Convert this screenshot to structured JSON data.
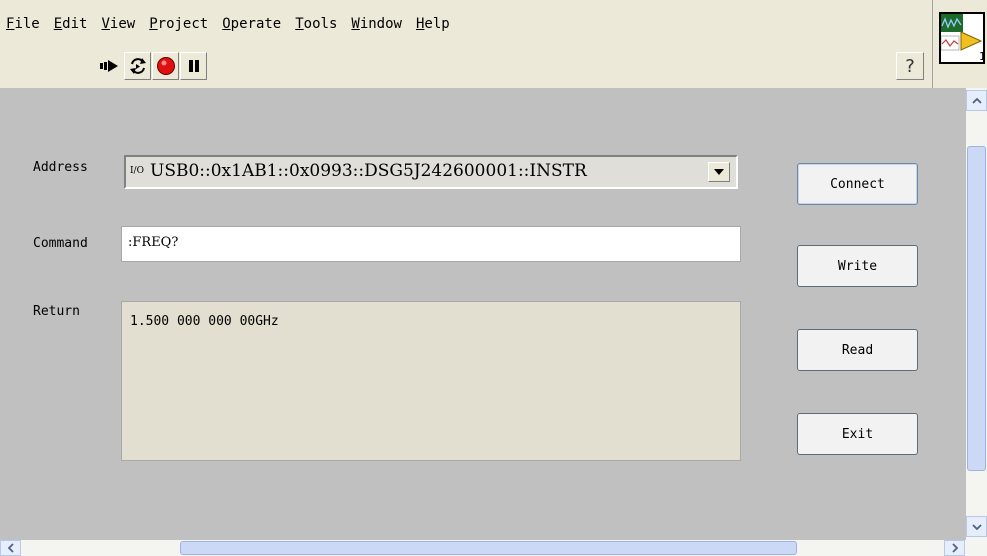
{
  "menu": {
    "items": [
      {
        "accel": "F",
        "rest": "ile"
      },
      {
        "accel": "E",
        "rest": "dit"
      },
      {
        "accel": "V",
        "rest": "iew"
      },
      {
        "accel": "P",
        "rest": "roject"
      },
      {
        "accel": "O",
        "rest": "perate"
      },
      {
        "accel": "T",
        "rest": "ools"
      },
      {
        "accel": "W",
        "rest": "indow"
      },
      {
        "accel": "H",
        "rest": "elp"
      }
    ]
  },
  "toolbar": {
    "icons": [
      "run-arrow-icon",
      "run-continuously-icon",
      "abort-execution-icon",
      "pause-icon"
    ],
    "help_glyph": "?"
  },
  "vi_icon": {
    "number": "1"
  },
  "panel": {
    "address_label": "Address",
    "address_prefix": "I/O",
    "address_value": "USB0::0x1AB1::0x0993::DSG5J242600001::INSTR",
    "command_label": "Command",
    "command_value": ":FREQ?",
    "return_label": "Return",
    "return_value": "1.500 000 000 00GHz"
  },
  "buttons": {
    "connect": "Connect",
    "write": "Write",
    "read": "Read",
    "exit": "Exit"
  },
  "colors": {
    "panel_bg": "#c0c0c0",
    "window_bg": "#ece9d8",
    "abort_red": "#e01010",
    "scroll_blue": "#cbd9f6"
  }
}
